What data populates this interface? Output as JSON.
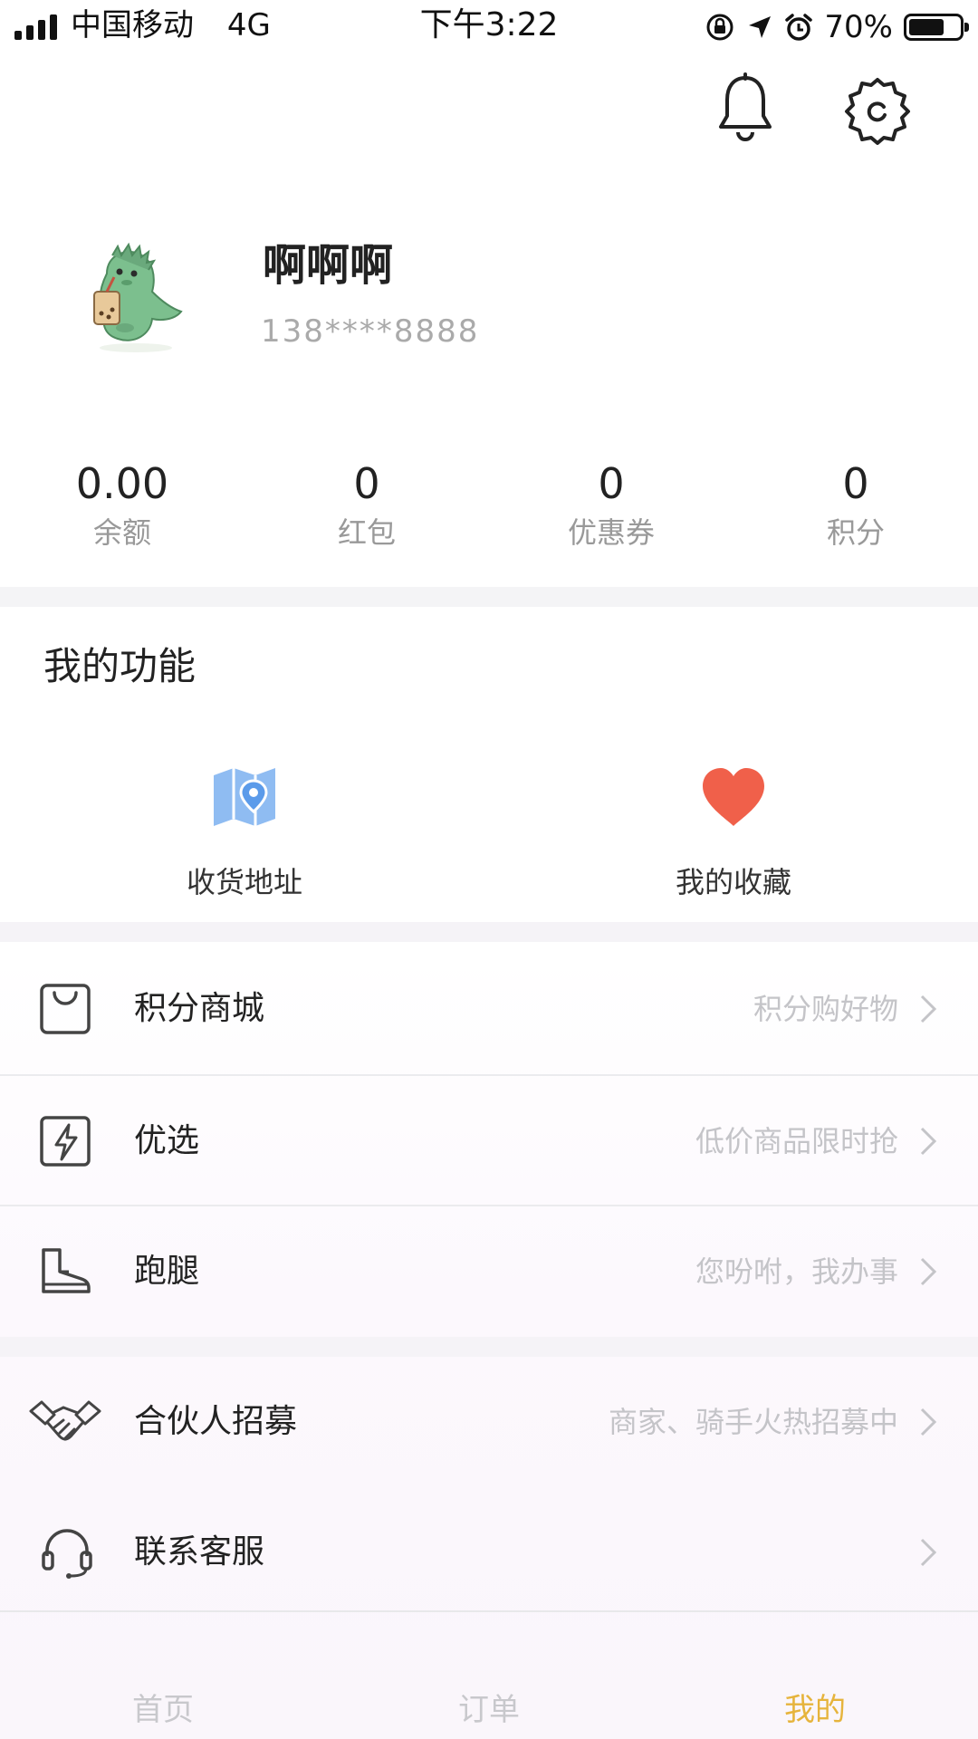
{
  "status_bar": {
    "carrier": "中国移动",
    "network": "4G",
    "time": "下午3:22",
    "battery": "70%",
    "battery_level": 0.7
  },
  "header": {
    "icons": [
      "bell-icon",
      "gear-icon"
    ]
  },
  "profile": {
    "name": "啊啊啊",
    "phone": "138****8888"
  },
  "stats": [
    {
      "value": "0.00",
      "label": "余额"
    },
    {
      "value": "0",
      "label": "红包"
    },
    {
      "value": "0",
      "label": "优惠券"
    },
    {
      "value": "0",
      "label": "积分"
    }
  ],
  "functions": {
    "title": "我的功能",
    "items": [
      {
        "label": "收货地址",
        "icon": "map-pin-icon",
        "color": "#5b9bea"
      },
      {
        "label": "我的收藏",
        "icon": "heart-icon",
        "color": "#f0604a"
      }
    ]
  },
  "menu": [
    {
      "label": "积分商城",
      "hint": "积分购好物",
      "icon": "shopping-bag-icon"
    },
    {
      "label": "优选",
      "hint": "低价商品限时抢",
      "icon": "lightning-icon"
    },
    {
      "label": "跑腿",
      "hint": "您吩咐，我办事",
      "icon": "boot-icon"
    },
    {
      "label": "合伙人招募",
      "hint": "商家、骑手火热招募中",
      "icon": "handshake-icon"
    },
    {
      "label": "联系客服",
      "hint": "",
      "icon": "headset-icon"
    }
  ],
  "tabs": [
    {
      "label": "首页",
      "active": false
    },
    {
      "label": "订单",
      "active": false
    },
    {
      "label": "我的",
      "active": true
    }
  ],
  "colors": {
    "accent": "#e6b43c",
    "hint_text": "#c4c4c8"
  }
}
